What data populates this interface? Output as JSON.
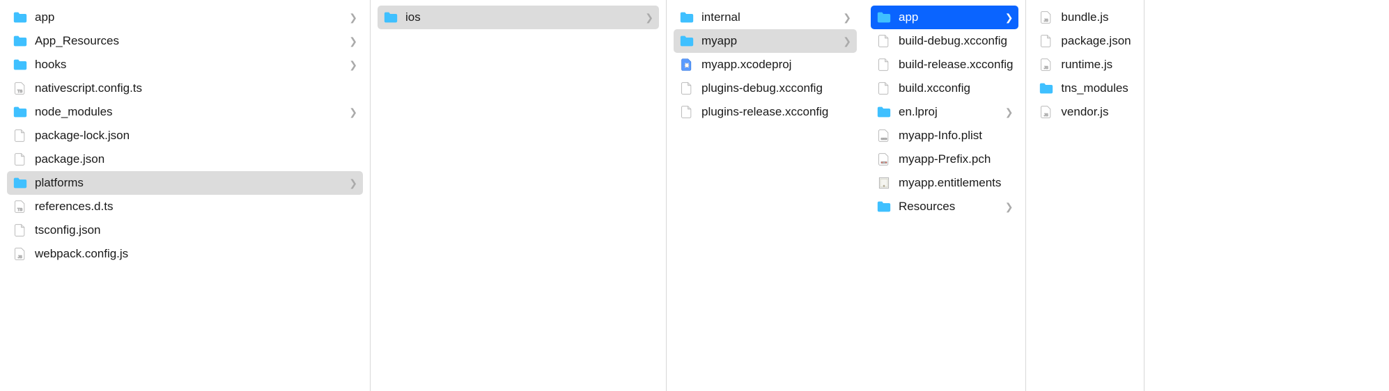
{
  "columns": [
    {
      "items": [
        {
          "name": "app",
          "type": "folder",
          "expandable": true,
          "state": "normal"
        },
        {
          "name": "App_Resources",
          "type": "folder",
          "expandable": true,
          "state": "normal"
        },
        {
          "name": "hooks",
          "type": "folder",
          "expandable": true,
          "state": "normal"
        },
        {
          "name": "nativescript.config.ts",
          "type": "ts",
          "expandable": false,
          "state": "normal"
        },
        {
          "name": "node_modules",
          "type": "folder",
          "expandable": true,
          "state": "normal"
        },
        {
          "name": "package-lock.json",
          "type": "file",
          "expandable": false,
          "state": "normal"
        },
        {
          "name": "package.json",
          "type": "file",
          "expandable": false,
          "state": "normal"
        },
        {
          "name": "platforms",
          "type": "folder",
          "expandable": true,
          "state": "selected-grey"
        },
        {
          "name": "references.d.ts",
          "type": "ts",
          "expandable": false,
          "state": "normal"
        },
        {
          "name": "tsconfig.json",
          "type": "file",
          "expandable": false,
          "state": "normal"
        },
        {
          "name": "webpack.config.js",
          "type": "js",
          "expandable": false,
          "state": "normal"
        }
      ]
    },
    {
      "items": [
        {
          "name": "ios",
          "type": "folder",
          "expandable": true,
          "state": "selected-grey"
        }
      ]
    },
    {
      "items": [
        {
          "name": "internal",
          "type": "folder",
          "expandable": true,
          "state": "normal"
        },
        {
          "name": "myapp",
          "type": "folder",
          "expandable": true,
          "state": "selected-grey"
        },
        {
          "name": "myapp.xcodeproj",
          "type": "xcodeproj",
          "expandable": false,
          "state": "normal"
        },
        {
          "name": "plugins-debug.xcconfig",
          "type": "file",
          "expandable": false,
          "state": "normal"
        },
        {
          "name": "plugins-release.xcconfig",
          "type": "file",
          "expandable": false,
          "state": "normal"
        }
      ]
    },
    {
      "items": [
        {
          "name": "app",
          "type": "folder",
          "expandable": true,
          "state": "selected-blue"
        },
        {
          "name": "build-debug.xcconfig",
          "type": "file",
          "expandable": false,
          "state": "normal"
        },
        {
          "name": "build-release.xcconfig",
          "type": "file",
          "expandable": false,
          "state": "normal"
        },
        {
          "name": "build.xcconfig",
          "type": "file",
          "expandable": false,
          "state": "normal"
        },
        {
          "name": "en.lproj",
          "type": "folder",
          "expandable": true,
          "state": "normal"
        },
        {
          "name": "myapp-Info.plist",
          "type": "plist",
          "expandable": false,
          "state": "normal"
        },
        {
          "name": "myapp-Prefix.pch",
          "type": "pch",
          "expandable": false,
          "state": "normal"
        },
        {
          "name": "myapp.entitlements",
          "type": "entitlements",
          "expandable": false,
          "state": "normal"
        },
        {
          "name": "Resources",
          "type": "folder",
          "expandable": true,
          "state": "normal"
        }
      ]
    },
    {
      "items": [
        {
          "name": "bundle.js",
          "type": "js",
          "expandable": false,
          "state": "normal"
        },
        {
          "name": "package.json",
          "type": "file",
          "expandable": false,
          "state": "normal"
        },
        {
          "name": "runtime.js",
          "type": "js",
          "expandable": false,
          "state": "normal"
        },
        {
          "name": "tns_modules",
          "type": "folder",
          "expandable": false,
          "state": "normal"
        },
        {
          "name": "vendor.js",
          "type": "js",
          "expandable": false,
          "state": "normal"
        }
      ]
    }
  ]
}
